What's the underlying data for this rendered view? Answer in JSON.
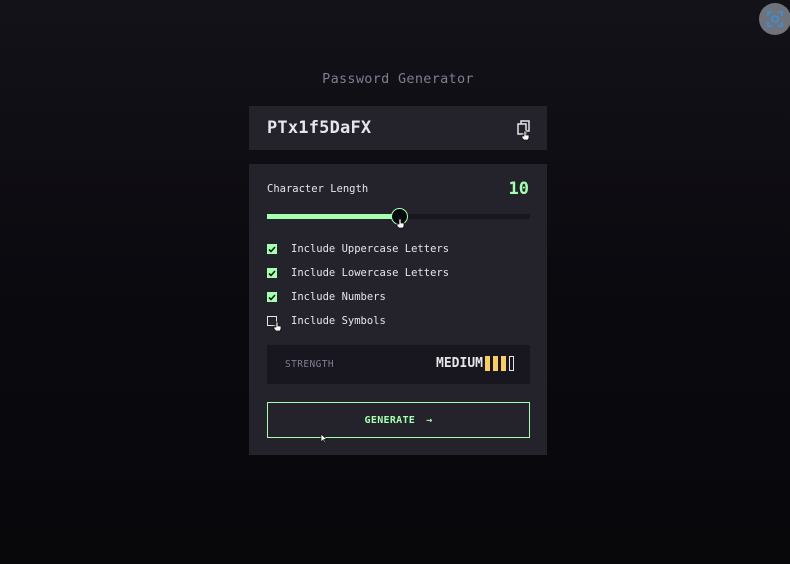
{
  "header": {
    "title": "Password Generator"
  },
  "output": {
    "password": "PTx1f5DaFX",
    "copy_icon": "copy-icon"
  },
  "length": {
    "label": "Character Length",
    "value": "10",
    "min": 0,
    "max": 20,
    "current": 10
  },
  "options": [
    {
      "label": "Include Uppercase Letters",
      "checked": true
    },
    {
      "label": "Include Lowercase Letters",
      "checked": true
    },
    {
      "label": "Include Numbers",
      "checked": true
    },
    {
      "label": "Include Symbols",
      "checked": false
    }
  ],
  "strength": {
    "label": "STRENGTH",
    "value": "MEDIUM",
    "level": 3,
    "max_level": 4
  },
  "generate": {
    "label": "GENERATE",
    "arrow": "→"
  },
  "colors": {
    "accent": "#a4ffaf",
    "panel": "#24232c",
    "text": "#e6e5ea",
    "muted": "#817d92",
    "strength_medium": "#f8cd65"
  }
}
